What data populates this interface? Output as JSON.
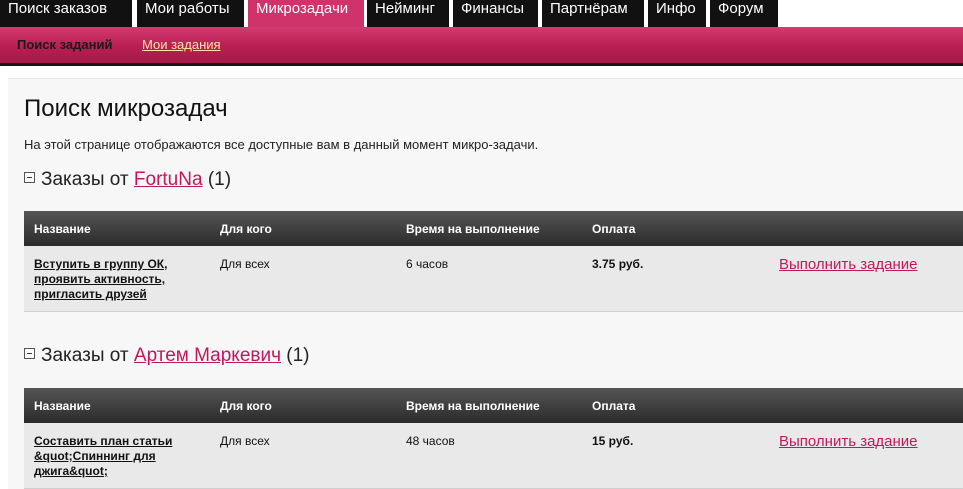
{
  "nav": {
    "tabs": [
      {
        "label": "Поиск заказов"
      },
      {
        "label": "Мои работы"
      },
      {
        "label": "Микрозадачи"
      },
      {
        "label": "Нейминг"
      },
      {
        "label": "Финансы"
      },
      {
        "label": "Партнёрам"
      },
      {
        "label": "Инфо"
      },
      {
        "label": "Форум"
      }
    ],
    "active_tab": "Микрозадачи"
  },
  "subnav": {
    "current": "Поиск заданий",
    "link": "Мои задания"
  },
  "page": {
    "title": "Поиск микрозадач",
    "description": "На этой странице отображаются все доступные вам в данный момент микро-задачи."
  },
  "table_headers": {
    "name": "Название",
    "for_whom": "Для кого",
    "time": "Время на выполнение",
    "payment": "Оплата"
  },
  "groups": [
    {
      "prefix": "Заказы от",
      "author": "FortuNa",
      "count": "(1)",
      "tasks": [
        {
          "name": "Вступить в группу ОК, проявить активность, пригласить друзей",
          "for_whom": "Для всех",
          "time": "6 часов",
          "payment": "3.75 руб.",
          "action": "Выполнить задание"
        }
      ]
    },
    {
      "prefix": "Заказы от",
      "author": "Артем Маркевич",
      "count": "(1)",
      "tasks": [
        {
          "name": "Составить план статьи &quot;Спиннинг для джига&quot;",
          "for_whom": "Для всех",
          "time": "48 часов",
          "payment": "15 руб.",
          "action": "Выполнить задание"
        }
      ]
    }
  ],
  "colors": {
    "accent": "#d0336a",
    "link": "#c2185b",
    "nav_bg": "#111111",
    "sublink": "#ffe6a8"
  }
}
